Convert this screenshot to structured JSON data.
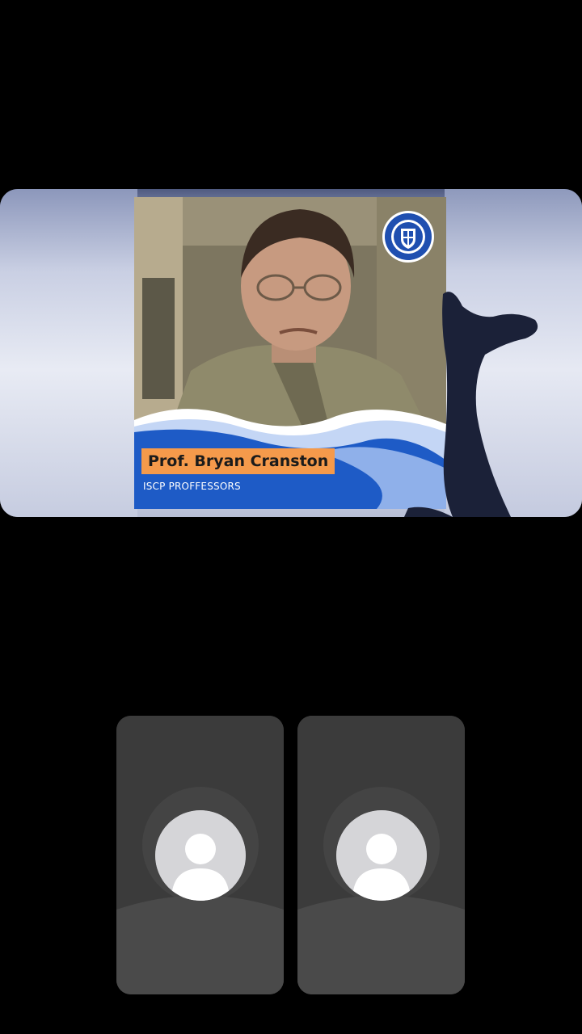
{
  "shared_screen": {
    "presenter_name": "Prof. Bryan Cranston",
    "presenter_group": "ISCP PROFFESSORS",
    "crest_icon": "college-crest-icon",
    "colors": {
      "name_tag": "#f59a4b",
      "wave_blue": "#1e5bc6",
      "wave_light": "#c4d6f5"
    }
  },
  "participants": [
    {
      "avatar_icon": "person-placeholder-icon"
    },
    {
      "avatar_icon": "person-placeholder-icon"
    }
  ]
}
